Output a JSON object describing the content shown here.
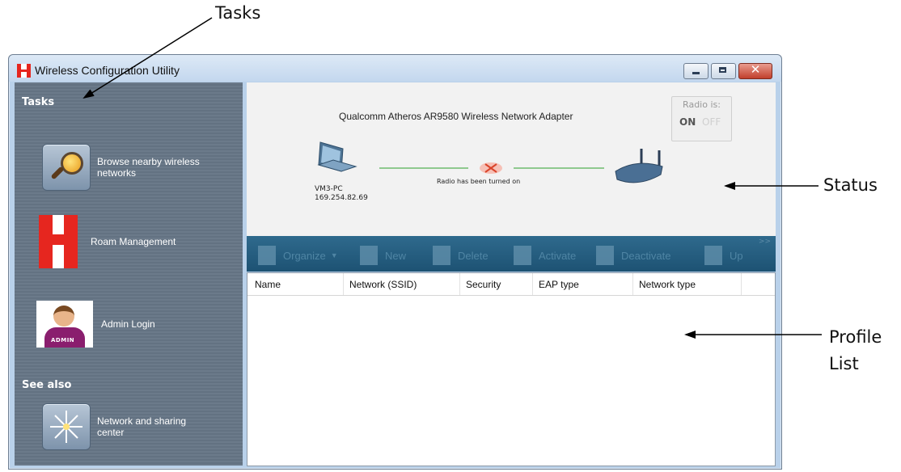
{
  "callouts": {
    "tasks": "Tasks",
    "status": "Status",
    "profile_line1": "Profile",
    "profile_line2": "List"
  },
  "window": {
    "title": "Wireless Configuration Utility",
    "controls": [
      "minimize",
      "maximize",
      "close"
    ]
  },
  "sidebar": {
    "tasks_heading": "Tasks",
    "items": [
      {
        "label_line1": "Browse nearby wireless",
        "label_line2": "networks",
        "icon": "magnifier-icon"
      },
      {
        "label": "Roam Management",
        "icon": "honeywell-logo-icon"
      },
      {
        "label": "Admin Login",
        "icon": "admin-avatar-icon",
        "icon_text": "ADMIN"
      }
    ],
    "see_also_heading": "See also",
    "see_also_items": [
      {
        "label_line1": "Network and sharing",
        "label_line2": "center",
        "icon": "network-star-icon"
      }
    ]
  },
  "status": {
    "adapter_name": "Qualcomm Atheros AR9580 Wireless Network Adapter",
    "radio_title": "Radio is:",
    "radio_on": "ON",
    "radio_off": "OFF",
    "pc_name": "VM3-PC",
    "pc_ip": "169.254.82.69",
    "radio_message": "Radio has been turned on"
  },
  "toolbar": {
    "items": [
      "Organize",
      "New",
      "Delete",
      "Activate",
      "Deactivate",
      "Up"
    ],
    "expand": ">>"
  },
  "profile_list": {
    "columns": [
      "Name",
      "Network (SSID)",
      "Security",
      "EAP type",
      "Network type"
    ],
    "rows": []
  },
  "colors": {
    "sidebar": "#6b7a8a",
    "toolbar": "#1d5273",
    "brand_red": "#e6261f",
    "status_bg": "#f2f2f2"
  }
}
